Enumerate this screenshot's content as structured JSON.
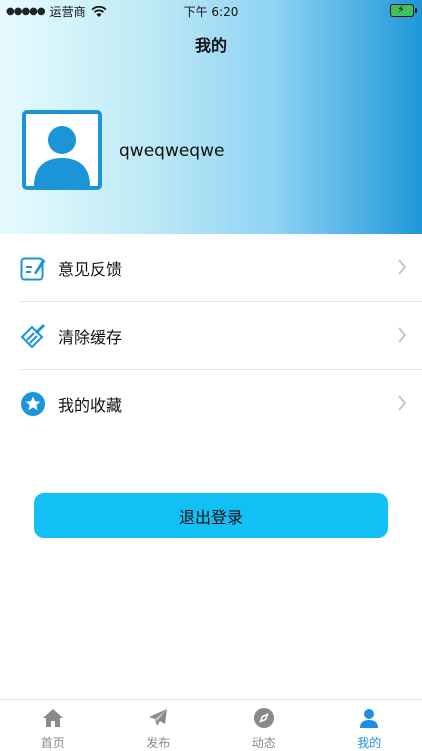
{
  "status_bar": {
    "carrier": "运营商",
    "time": "下午 6:20"
  },
  "header": {
    "title": "我的",
    "username": "qweqweqwe"
  },
  "menu": [
    {
      "label": "意见反馈",
      "icon": "feedback-icon"
    },
    {
      "label": "清除缓存",
      "icon": "broom-icon"
    },
    {
      "label": "我的收藏",
      "icon": "star-icon"
    }
  ],
  "logout_label": "退出登录",
  "tabs": [
    {
      "label": "首页",
      "icon": "home-icon"
    },
    {
      "label": "发布",
      "icon": "paper-plane-icon"
    },
    {
      "label": "动态",
      "icon": "compass-icon"
    },
    {
      "label": "我的",
      "icon": "person-icon",
      "active": true
    }
  ],
  "colors": {
    "accent": "#1d8fe0",
    "button": "#12c0f5"
  }
}
